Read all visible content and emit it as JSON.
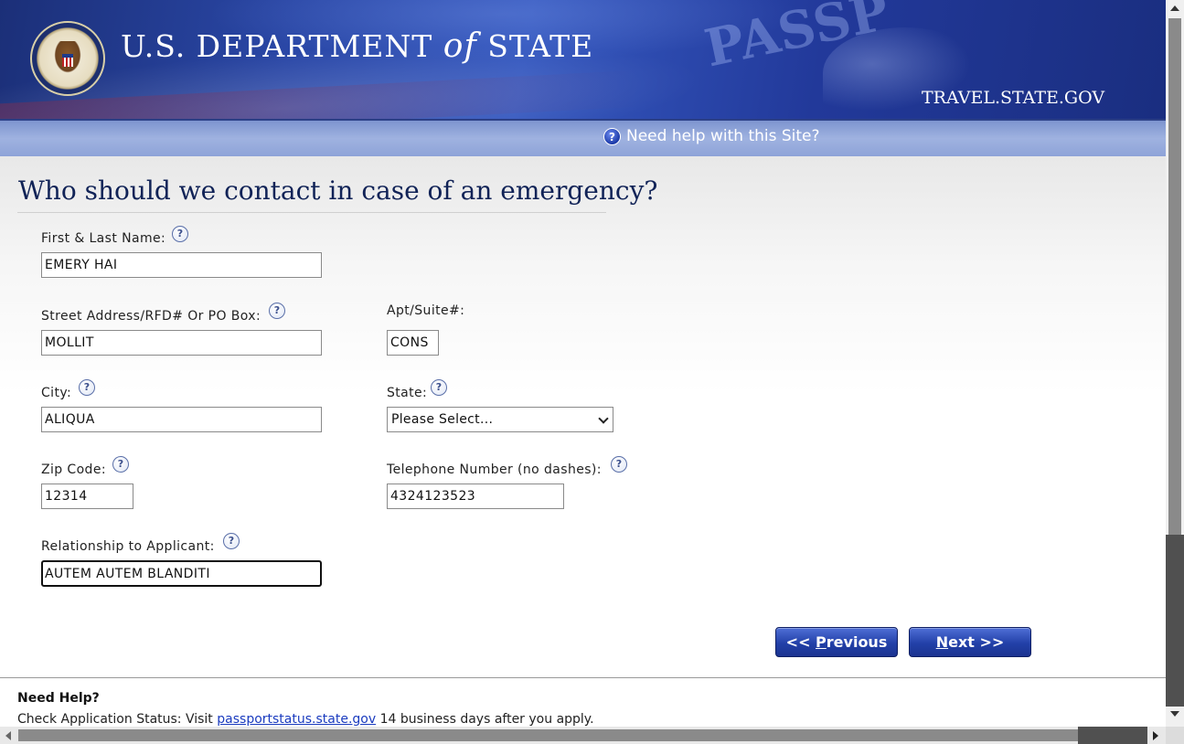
{
  "header": {
    "dept_prefix": "U.S. DEPARTMENT",
    "dept_of": "of",
    "dept_suffix": "STATE",
    "passport_watermark": "PASSP",
    "site": "TRAVEL.STATE.GOV",
    "help_link": "Need help with this Site?"
  },
  "page": {
    "title": "Who should we contact in case of an emergency?"
  },
  "form": {
    "name": {
      "label": "First & Last Name:",
      "value": "EMERY HAI"
    },
    "street": {
      "label": "Street Address/RFD# Or PO Box:",
      "value": "MOLLIT"
    },
    "apt": {
      "label": "Apt/Suite#:",
      "value": "CONS"
    },
    "city": {
      "label": "City:",
      "value": "ALIQUA"
    },
    "state": {
      "label": "State:",
      "value": "Please Select..."
    },
    "zip": {
      "label": "Zip Code:",
      "value": "12314"
    },
    "phone": {
      "label": "Telephone Number (no dashes):",
      "value": "4324123523"
    },
    "relationship": {
      "label": "Relationship to Applicant:",
      "value": "AUTEM AUTEM BLANDITI"
    }
  },
  "buttons": {
    "previous_arrows": "<<",
    "previous_accesskey": "P",
    "previous_rest": "revious",
    "next_accesskey": "N",
    "next_rest": "ext >>"
  },
  "footer": {
    "title": "Need Help?",
    "status_prefix": "Check Application Status: Visit ",
    "status_link": "passportstatus.state.gov",
    "status_suffix": " 14 business days after you apply."
  },
  "icons": {
    "help_circle": "?"
  },
  "colors": {
    "brand_blue": "#1b3390",
    "title_navy": "#112357",
    "link_blue": "#1a3bbf"
  }
}
